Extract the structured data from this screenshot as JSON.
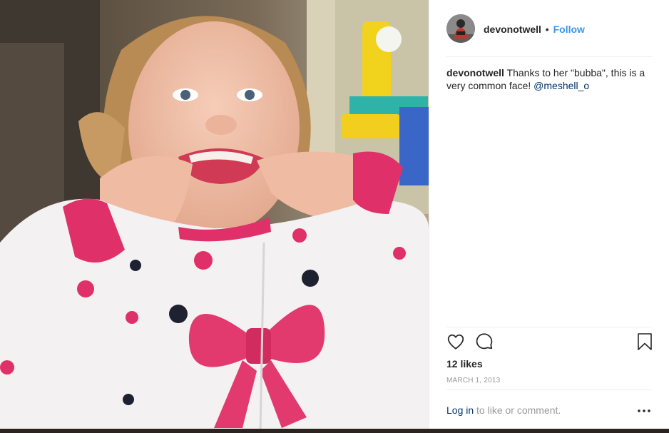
{
  "photo": {
    "description_icon": "photo-icon"
  },
  "header": {
    "username": "devonotwell",
    "separator": "•",
    "follow_label": "Follow"
  },
  "caption": {
    "username": "devonotwell",
    "text": " Thanks to her \"bubba\", this is a very common face! ",
    "mention": "@meshell_o"
  },
  "actions": {
    "like_icon": "heart-icon",
    "comment_icon": "comment-icon",
    "save_icon": "bookmark-icon"
  },
  "likes": "12 likes",
  "timestamp": "MARCH 1, 2013",
  "login": {
    "link": "Log in",
    "text": " to like or comment."
  },
  "more_icon": "more-options-icon",
  "colors": {
    "accent": "#3897f0",
    "link": "#003569",
    "text": "#262626",
    "muted": "#999999"
  }
}
